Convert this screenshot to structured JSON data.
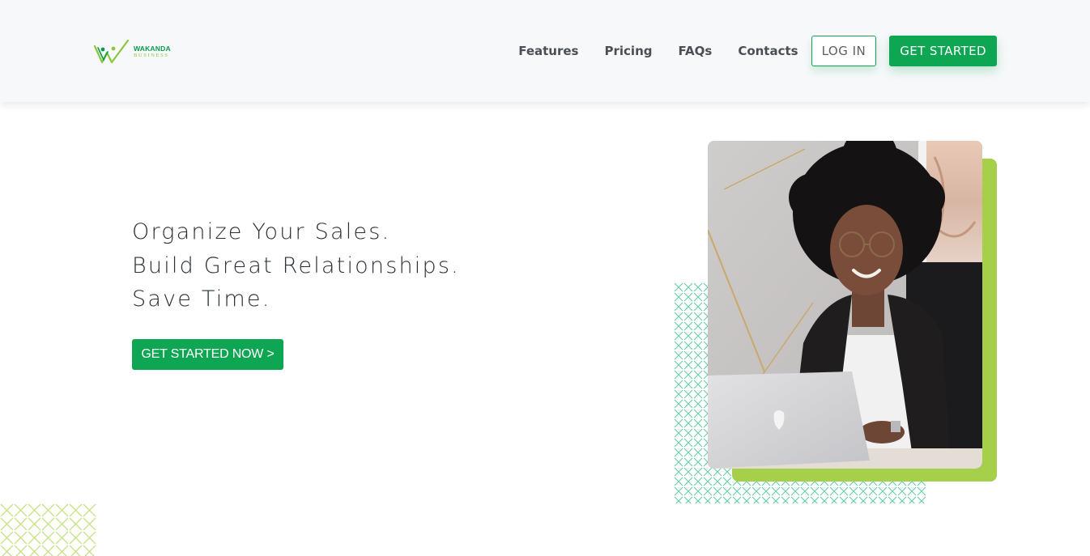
{
  "brand": {
    "name_line1": "WAKANDA",
    "name_line2": "BUSINESS",
    "logo_icon": "wakanda-w-mark-icon",
    "colors": {
      "primary": "#0fa653",
      "accent": "#a6d049",
      "text_dark": "#2b3036"
    }
  },
  "nav": {
    "links": [
      {
        "label": "Features"
      },
      {
        "label": "Pricing"
      },
      {
        "label": "FAQs"
      },
      {
        "label": "Contacts"
      }
    ],
    "login_label": "LOG IN",
    "get_started_label": "GET STARTED"
  },
  "hero": {
    "lines": [
      "Organize Your Sales.",
      "Build Great Relationships.",
      "Save Time."
    ],
    "cta_label": "GET STARTED NOW >",
    "image_subject": "woman-with-laptop-photo"
  }
}
